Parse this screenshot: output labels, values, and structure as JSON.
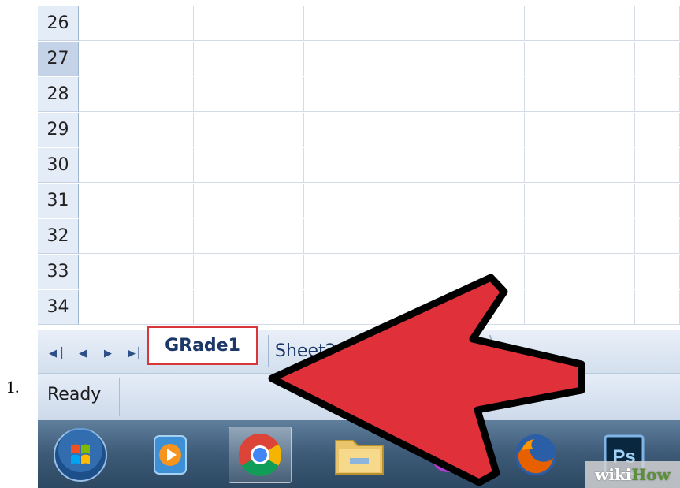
{
  "list_marker": "1.",
  "grid": {
    "rows": [
      {
        "label": "26",
        "selected": false
      },
      {
        "label": "27",
        "selected": true
      },
      {
        "label": "28",
        "selected": false
      },
      {
        "label": "29",
        "selected": false
      },
      {
        "label": "30",
        "selected": false
      },
      {
        "label": "31",
        "selected": false
      },
      {
        "label": "32",
        "selected": false
      },
      {
        "label": "33",
        "selected": false
      },
      {
        "label": "34",
        "selected": false
      }
    ]
  },
  "sheet_tabs": {
    "active": "GRade1",
    "next": "Sheet2"
  },
  "status": {
    "text": "Ready"
  },
  "taskbar": {
    "items": [
      "start-orb",
      "media-player",
      "chrome",
      "file-explorer",
      "messenger",
      "firefox",
      "photoshop"
    ],
    "photoshop_label": "Ps"
  },
  "watermark": {
    "prefix": "wiki",
    "suffix": "How"
  },
  "colors": {
    "arrow_fill": "#e0303a",
    "tab_highlight": "#d9363a",
    "tab_text": "#1b3868"
  }
}
